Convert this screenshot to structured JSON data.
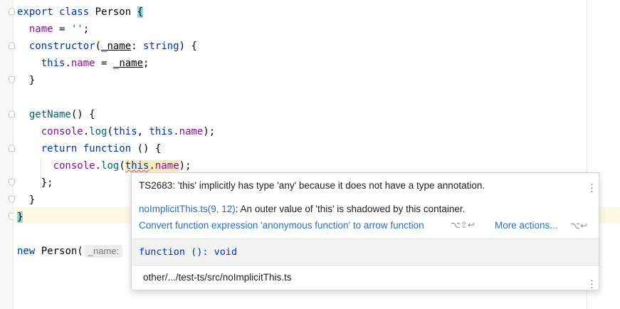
{
  "editor": {
    "lines": {
      "l1": {
        "kw": "export class",
        "name": " Person ",
        "brace": "{"
      },
      "l2": {
        "prop": "name",
        "rest": " = ",
        "str": "''",
        "semi": ";"
      },
      "l3": {
        "kw": "constructor",
        "open": "(",
        "param": "_name",
        "colon": ": ",
        "type": "string",
        "close": ") {"
      },
      "l4": {
        "kw": "this",
        "dot": ".",
        "prop": "name",
        "eq": " = ",
        "param": "_name",
        "semi": ";"
      },
      "l5": {
        "text": "}"
      },
      "l7": {
        "fn": "getName",
        "rest": "() {"
      },
      "l8": {
        "obj": "console",
        "dot": ".",
        "fn": "log",
        "open": "(",
        "kw1": "this",
        "comma": ", ",
        "kw2": "this",
        "dot2": ".",
        "prop": "name",
        "close": ");"
      },
      "l9": {
        "kw": "return function",
        "rest": " () {"
      },
      "l10": {
        "obj": "console",
        "dot": ".",
        "fn": "log",
        "open": "(",
        "kw": "this",
        "dot2": ".",
        "prop": "name",
        "close": ");"
      },
      "l11": {
        "text": "};"
      },
      "l12": {
        "text": "}"
      },
      "l13": {
        "text": "}"
      },
      "l15": {
        "kw": "new",
        "cls": " Person(",
        "hint": "_name:",
        "str": " '/"
      }
    }
  },
  "popup": {
    "message": "TS2683: 'this' implicitly has type 'any' because it does not have a type annotation.",
    "related_link": "noImplicitThis.ts(9, 12)",
    "related_text": ": An outer value of 'this' is shadowed by this container.",
    "action_convert": "Convert function expression 'anonymous function' to arrow function",
    "action_convert_shortcut": "⌥⇧↩",
    "action_more": "More actions...",
    "action_more_shortcut": "⌥↩",
    "signature": "function (): void",
    "path": "other/.../test-ts/src/noImplicitThis.ts"
  },
  "colors": {
    "keyword": "#0033b3",
    "property": "#871094",
    "function": "#00627a",
    "string": "#067d17",
    "link": "#2a6dc9",
    "brace_highlight": "#93d9d9"
  },
  "icons": {
    "fold": "fold-marker-icon",
    "menu": "more-vertical-icon"
  }
}
